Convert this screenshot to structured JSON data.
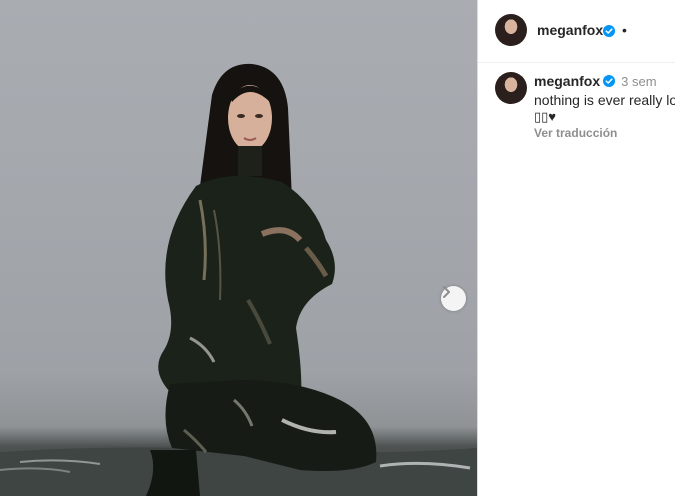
{
  "post": {
    "photo_alt": "photo",
    "next_icon": "chevron-right-icon"
  },
  "header": {
    "username": "meganfox",
    "verified_icon": "verified-badge-icon",
    "separator": "•"
  },
  "comment": {
    "username": "meganfox",
    "time": "3 sem",
    "text": "nothing is ever really lo",
    "emoji_line": "▯▯♥",
    "translate_label": "Ver traducción"
  },
  "colors": {
    "verified_blue": "#0095f6",
    "text_primary": "#262626",
    "text_secondary": "#8e8e8e"
  }
}
